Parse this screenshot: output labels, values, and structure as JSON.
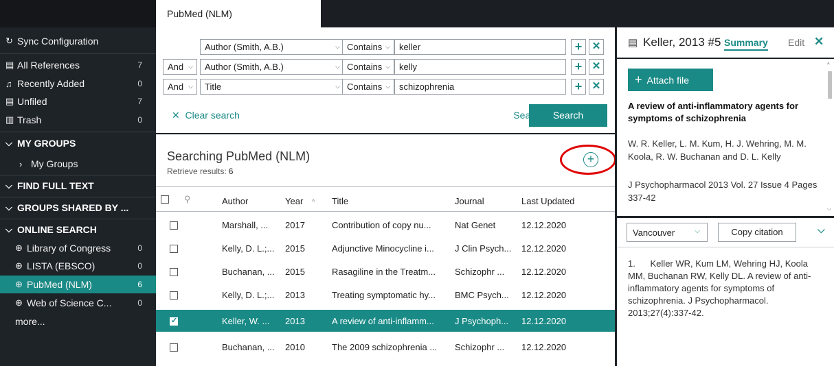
{
  "tab": {
    "label": "PubMed (NLM)"
  },
  "sidebar": {
    "sync": "Sync Configuration",
    "items": [
      {
        "label": "All References",
        "count": "7"
      },
      {
        "label": "Recently Added",
        "count": "0"
      },
      {
        "label": "Unfiled",
        "count": "7"
      },
      {
        "label": "Trash",
        "count": "0"
      }
    ],
    "my_groups": "MY GROUPS",
    "my_groups_item": "My Groups",
    "find_full_text": "FIND FULL TEXT",
    "groups_shared": "GROUPS SHARED BY ...",
    "online_search": "ONLINE SEARCH",
    "online_items": [
      {
        "label": "Library of Congress",
        "count": "0"
      },
      {
        "label": "LISTA (EBSCO)",
        "count": "0"
      },
      {
        "label": "PubMed (NLM)",
        "count": "6"
      },
      {
        "label": "Web of Science C...",
        "count": "0"
      }
    ],
    "more": "more..."
  },
  "search": {
    "rows": [
      {
        "op": "",
        "field": "Author (Smith, A.B.)",
        "cond": "Contains",
        "value": "keller"
      },
      {
        "op": "And",
        "field": "Author (Smith, A.B.)",
        "cond": "Contains",
        "value": "kelly"
      },
      {
        "op": "And",
        "field": "Title",
        "cond": "Contains",
        "value": "schizophrenia"
      }
    ],
    "clear": "Clear search",
    "options": "Search options",
    "button": "Search"
  },
  "results": {
    "title": "Searching PubMed (NLM)",
    "retrieve_label": "Retrieve results:",
    "retrieve_count": "6"
  },
  "table": {
    "headers": {
      "author": "Author",
      "year": "Year",
      "title": "Title",
      "journal": "Journal",
      "updated": "Last Updated"
    },
    "rows": [
      {
        "author": "Marshall, ...",
        "year": "2017",
        "title": "Contribution of copy nu...",
        "journal": "Nat Genet",
        "updated": "12.12.2020",
        "checked": false
      },
      {
        "author": "Kelly, D. L.;...",
        "year": "2015",
        "title": "Adjunctive Minocycline i...",
        "journal": "J Clin Psych...",
        "updated": "12.12.2020",
        "checked": false
      },
      {
        "author": "Buchanan, ...",
        "year": "2015",
        "title": "Rasagiline in the Treatm...",
        "journal": "Schizophr ...",
        "updated": "12.12.2020",
        "checked": false
      },
      {
        "author": "Kelly, D. L.;...",
        "year": "2013",
        "title": "Treating symptomatic hy...",
        "journal": "BMC Psych...",
        "updated": "12.12.2020",
        "checked": false
      },
      {
        "author": "Keller, W. ...",
        "year": "2013",
        "title": "A review of anti-inflamm...",
        "journal": "J Psychoph...",
        "updated": "12.12.2020",
        "checked": true
      },
      {
        "author": "Buchanan, ...",
        "year": "2010",
        "title": "The 2009 schizophrenia ...",
        "journal": "Schizophr ...",
        "updated": "12.12.2020",
        "checked": false
      }
    ]
  },
  "detail": {
    "ref": "Keller, 2013 #5",
    "summary_tab": "Summary",
    "edit_tab": "Edit",
    "attach": "Attach file",
    "title": "A review of anti-inflammatory agents for symptoms of schizophrenia",
    "authors": "W. R. Keller, L. M. Kum, H. J. Wehring, M. M. Koola, R. W. Buchanan and D. L. Kelly",
    "journal": "J Psychopharmacol 2013 Vol. 27 Issue 4 Pages 337-42",
    "style": "Vancouver",
    "copy_citation": "Copy citation",
    "citation": "1.      Keller WR, Kum LM, Wehring HJ, Koola MM, Buchanan RW, Kelly DL. A review of anti-inflammatory agents for symptoms of schizophrenia. J Psychopharmacol. 2013;27(4):337-42."
  },
  "colors": {
    "accent": "#1a8a86",
    "sidebar": "#1e2328",
    "highlight": "#e00000"
  }
}
